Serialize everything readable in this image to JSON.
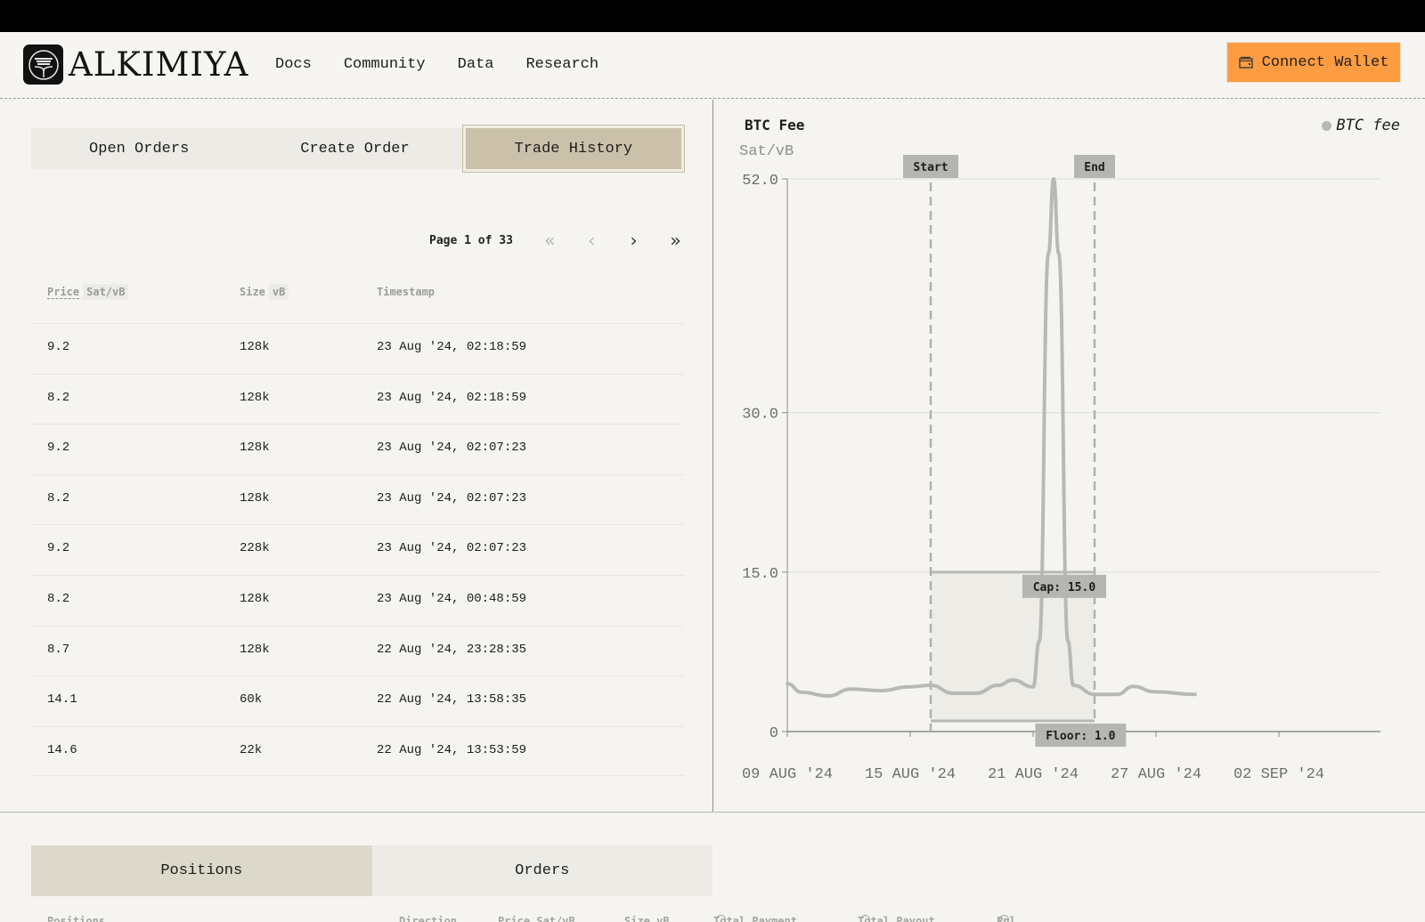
{
  "header": {
    "brand": "ALKIMIYA",
    "nav": [
      "Docs",
      "Community",
      "Data",
      "Research"
    ],
    "wallet_button": "Connect Wallet",
    "accent_color": "#fd9c40"
  },
  "left_panel": {
    "tabs": [
      {
        "label": "Open Orders",
        "active": false
      },
      {
        "label": "Create Order",
        "active": false
      },
      {
        "label": "Trade History",
        "active": true
      }
    ],
    "pager": {
      "label": "Page 1 of 33",
      "current": 1,
      "total": 33,
      "first_icon": "double-chevron-left-icon",
      "prev_icon": "chevron-left-icon",
      "next_icon": "chevron-right-icon",
      "last_icon": "double-chevron-right-icon"
    },
    "table": {
      "columns": [
        {
          "label": "Price",
          "unit": "Sat/vB"
        },
        {
          "label": "Size",
          "unit": "vB"
        },
        {
          "label": "Timestamp",
          "unit": ""
        }
      ],
      "rows": [
        {
          "price": "9.2",
          "size": "128k",
          "timestamp": "23 Aug '24, 02:18:59"
        },
        {
          "price": "8.2",
          "size": "128k",
          "timestamp": "23 Aug '24, 02:18:59"
        },
        {
          "price": "9.2",
          "size": "128k",
          "timestamp": "23 Aug '24, 02:07:23"
        },
        {
          "price": "8.2",
          "size": "128k",
          "timestamp": "23 Aug '24, 02:07:23"
        },
        {
          "price": "9.2",
          "size": "228k",
          "timestamp": "23 Aug '24, 02:07:23"
        },
        {
          "price": "8.2",
          "size": "128k",
          "timestamp": "23 Aug '24, 00:48:59"
        },
        {
          "price": "8.7",
          "size": "128k",
          "timestamp": "22 Aug '24, 23:28:35"
        },
        {
          "price": "14.1",
          "size": "60k",
          "timestamp": "22 Aug '24, 13:58:35"
        },
        {
          "price": "14.6",
          "size": "22k",
          "timestamp": "22 Aug '24, 13:53:59"
        }
      ]
    }
  },
  "chart_data": {
    "type": "line",
    "title": "BTC Fee",
    "ylabel": "Sat/vB",
    "xlabel": "",
    "legend": {
      "label": "BTC fee",
      "position": "top-right"
    },
    "ylim": [
      0,
      52
    ],
    "yticks": [
      {
        "value": 0,
        "label": "0"
      },
      {
        "value": 15,
        "label": "15.0"
      },
      {
        "value": 30,
        "label": "30.0"
      },
      {
        "value": 52,
        "label": "52.0"
      }
    ],
    "xlim_days": [
      0,
      24.5
    ],
    "xticks": [
      {
        "day": 0,
        "label": "09 AUG '24"
      },
      {
        "day": 6,
        "label": "15 AUG '24"
      },
      {
        "day": 12,
        "label": "21 AUG '24"
      },
      {
        "day": 18,
        "label": "27 AUG '24"
      },
      {
        "day": 24,
        "label": "02 SEP '24"
      }
    ],
    "x_origin": "09 Aug 2024",
    "series": [
      {
        "name": "BTC fee",
        "color": "#b8b8b4",
        "points": [
          [
            0,
            4.5
          ],
          [
            0.7,
            3.7
          ],
          [
            2.0,
            3.35
          ],
          [
            3.1,
            4.0
          ],
          [
            4.6,
            3.85
          ],
          [
            5.9,
            4.2
          ],
          [
            7.0,
            4.35
          ],
          [
            8.1,
            3.6
          ],
          [
            9.2,
            3.6
          ],
          [
            10.3,
            4.35
          ],
          [
            11.0,
            4.85
          ],
          [
            12.0,
            4.2
          ],
          [
            12.3,
            8.5
          ],
          [
            12.75,
            45
          ],
          [
            13.0,
            52
          ],
          [
            13.25,
            45
          ],
          [
            13.7,
            8.5
          ],
          [
            13.96,
            4.35
          ],
          [
            15.0,
            3.5
          ],
          [
            16.1,
            3.5
          ],
          [
            16.9,
            4.25
          ],
          [
            17.9,
            3.75
          ],
          [
            19.9,
            3.5
          ]
        ]
      }
    ],
    "annotations": {
      "start": {
        "label": "Start",
        "day": 7.0
      },
      "end": {
        "label": "End",
        "day": 15.0
      },
      "cap": {
        "label": "Cap: 15.0",
        "value": 15.0
      },
      "floor": {
        "label": "Floor: 1.0",
        "value": 1.0
      }
    }
  },
  "bottom": {
    "tabs": [
      {
        "label": "Positions",
        "active": true
      },
      {
        "label": "Orders",
        "active": false
      }
    ],
    "columns": [
      "Positions",
      "Direction",
      "Price Sat/vB",
      "Size vB",
      "Total Payment",
      "Total Payout",
      "Pnl"
    ]
  }
}
